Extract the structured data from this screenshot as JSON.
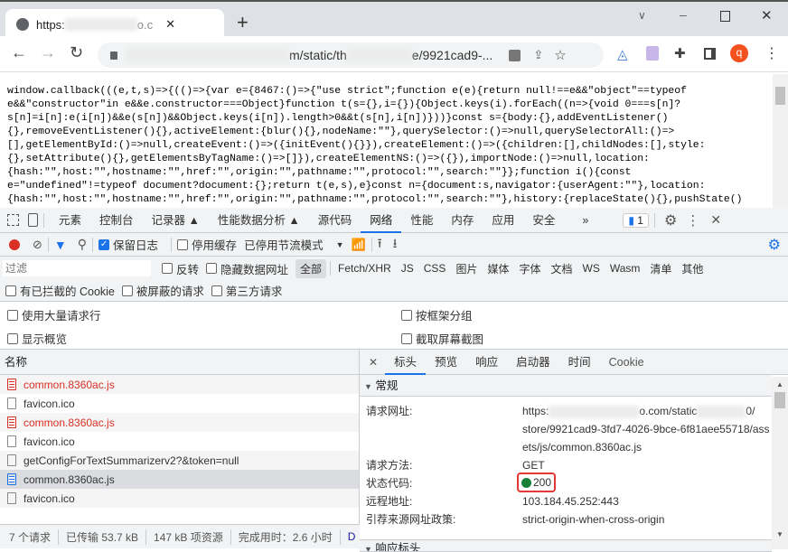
{
  "browser": {
    "tab_title": "https:",
    "tab_title_suffix": "o.c",
    "new_tab": "+",
    "url_mid": "m/static/th",
    "url_end": "e/9921cad9-...",
    "profile_initial": "q"
  },
  "page": {
    "code_lines": [
      "window.callback(((e,t,s)=>{(()=>{var e={8467:()=>{\"use strict\";function e(e){return null!==e&&\"object\"==typeof",
      "e&&\"constructor\"in e&&e.constructor===Object}function t(s={},i={}){Object.keys(i).forEach((n=>{void 0===s[n]?",
      "s[n]=i[n]:e(i[n])&&e(s[n])&&Object.keys(i[n]).length>0&&t(s[n],i[n])}))}const s={body:{},addEventListener()",
      "{},removeEventListener(){},activeElement:{blur(){},nodeName:\"\"},querySelector:()=>null,querySelectorAll:()=>",
      "[],getElementById:()=>null,createEvent:()=>({initEvent(){}}),createElement:()=>({children:[],childNodes:[],style:",
      "{},setAttribute(){},getElementsByTagName:()=>[]}),createElementNS:()=>({}),importNode:()=>null,location:",
      "{hash:\"\",host:\"\",hostname:\"\",href:\"\",origin:\"\",pathname:\"\",protocol:\"\",search:\"\"}};function i(){const",
      "e=\"undefined\"!=typeof document?document:{};return t(e,s),e}const n={document:s,navigator:{userAgent:\"\"},location:",
      "{hash:\"\",host:\"\",hostname:\"\",href:\"\",origin:\"\",pathname:\"\",protocol:\"\",search:\"\"},history:{replaceState(){},pushState()"
    ]
  },
  "devtools": {
    "tabs": [
      "元素",
      "控制台",
      "记录器",
      "性能数据分析",
      "源代码",
      "网络",
      "性能",
      "内存",
      "应用",
      "安全"
    ],
    "more": "»",
    "issues_count": "1",
    "toolbar": {
      "preserve_log": "保留日志",
      "disable_cache": "停用缓存",
      "throttling": "已停用节流模式"
    },
    "filter": {
      "placeholder": "过滤",
      "invert": "反转",
      "hide_data_urls": "隐藏数据网址",
      "types": [
        "全部",
        "Fetch/XHR",
        "JS",
        "CSS",
        "图片",
        "媒体",
        "字体",
        "文档",
        "WS",
        "Wasm",
        "清单",
        "其他"
      ]
    },
    "cookie_filters": [
      "有已拦截的 Cookie",
      "被屏蔽的请求",
      "第三方请求"
    ],
    "settings": {
      "big_rows": "使用大量请求行",
      "group_by_frame": "按框架分组",
      "overview": "显示概览",
      "screenshots": "截取屏幕截图"
    },
    "list": {
      "header": "名称",
      "items": [
        {
          "name": "common.8360ac.js",
          "type": "err"
        },
        {
          "name": "favicon.ico",
          "type": "plain"
        },
        {
          "name": "common.8360ac.js",
          "type": "err"
        },
        {
          "name": "favicon.ico",
          "type": "plain"
        },
        {
          "name": "getConfigForTextSummarizerv2?&token=null",
          "type": "plain"
        },
        {
          "name": "common.8360ac.js",
          "type": "sel"
        },
        {
          "name": "favicon.ico",
          "type": "plain"
        }
      ]
    },
    "status": {
      "requests": "7 个请求",
      "transferred": "已传输 53.7 kB",
      "resources": "147 kB 项资源",
      "finish": "完成用时：2.6 小时",
      "dom": "D"
    },
    "detail": {
      "tabs": [
        "标头",
        "预览",
        "响应",
        "启动器",
        "时间",
        "Cookie"
      ],
      "general": "常规",
      "request_url_label": "请求网址:",
      "request_url_1a": "https:",
      "request_url_1b": "o.com/static",
      "request_url_1c": "0/",
      "request_url_2": "store/9921cad9-3fd7-4026-9bce-6f81aee55718/ass",
      "request_url_3": "ets/js/common.8360ac.js",
      "method_label": "请求方法:",
      "method": "GET",
      "status_label": "状态代码:",
      "status": "200",
      "remote_label": "远程地址:",
      "remote": "103.184.45.252:443",
      "referrer_label": "引荐来源网址政策:",
      "referrer": "strict-origin-when-cross-origin",
      "response_headers": "响应标头"
    }
  }
}
